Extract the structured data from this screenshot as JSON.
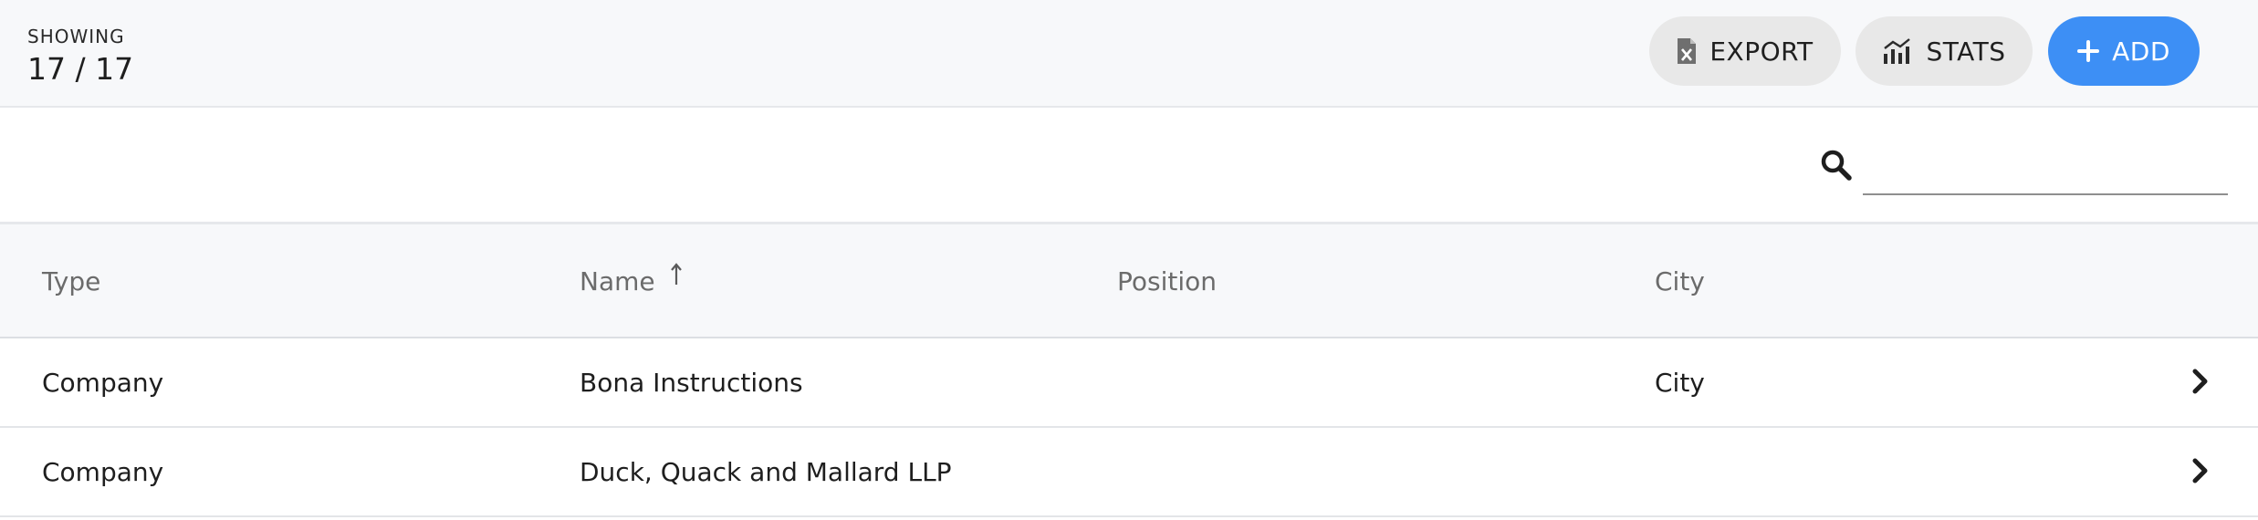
{
  "header": {
    "showing_label": "SHOWING",
    "showing_count": "17 / 17",
    "buttons": {
      "export": {
        "label": "EXPORT",
        "icon": "excel-file-icon"
      },
      "stats": {
        "label": "STATS",
        "icon": "bar-chart-icon"
      },
      "add": {
        "label": "ADD",
        "icon": "plus-icon"
      }
    }
  },
  "search": {
    "icon": "search-icon",
    "value": "",
    "placeholder": ""
  },
  "table": {
    "columns": [
      "Type",
      "Name",
      "Position",
      "City"
    ],
    "sort_icon": "arrow-up-icon",
    "rows": [
      {
        "type": "Company",
        "name": "Bona Instructions",
        "position": "",
        "city": "City"
      },
      {
        "type": "Company",
        "name": "Duck, Quack and Mallard LLP",
        "position": "",
        "city": ""
      }
    ],
    "row_action_icon": "chevron-right-icon"
  },
  "colors": {
    "accent": "#3d8ff5",
    "topbar_bg": "#f7f8fa",
    "button_gray": "#e8e8e8"
  }
}
